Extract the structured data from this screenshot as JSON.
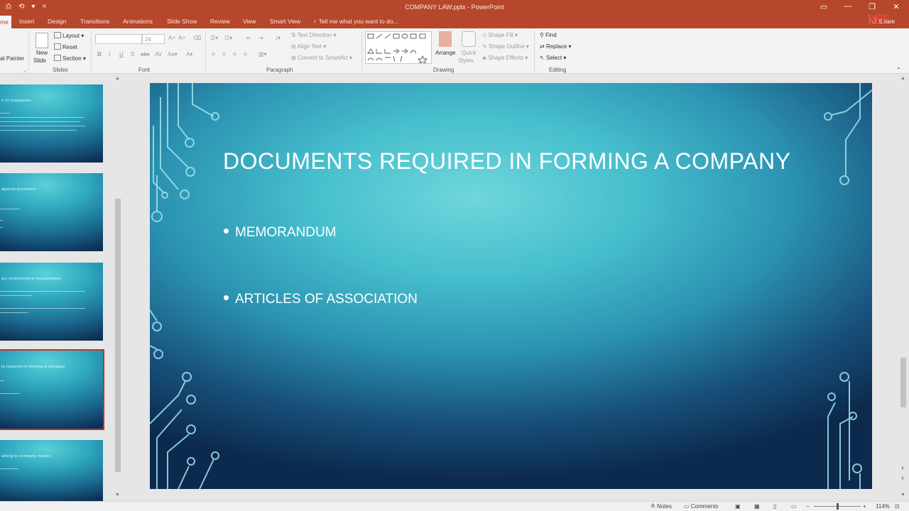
{
  "titlebar": {
    "title": "COMPANY LAW.pptx - PowerPoint",
    "quick_access": [
      "⎙",
      "⟲",
      "▾",
      "="
    ],
    "window_controls": [
      "▭",
      "—",
      "❐",
      "✕"
    ]
  },
  "tabs": [
    "me",
    "Insert",
    "Design",
    "Transitions",
    "Animations",
    "Slide Show",
    "Review",
    "View",
    "Smart View"
  ],
  "tell_me": "Tell me what you want to do...",
  "share": "Share",
  "watermark": "MP",
  "ribbon": {
    "clipboard": {
      "format_painter": "at Painter"
    },
    "slides": {
      "new_slide": "New",
      "new_slide2": "Slide",
      "layout": "Layout",
      "reset": "Reset",
      "section": "Section",
      "label": "Slides"
    },
    "font": {
      "size": "24",
      "label": "Font"
    },
    "paragraph": {
      "text_direction": "Text Direction",
      "align_text": "Align Text",
      "convert_smartart": "Convert to SmartArt",
      "label": "Paragraph"
    },
    "drawing": {
      "arrange": "Arrange",
      "quick_styles": "Quick",
      "quick_styles2": "Styles",
      "shape_fill": "Shape Fill",
      "shape_outline": "Shape Outline",
      "shape_effects": "Shape Effects",
      "label": "Drawing"
    },
    "editing": {
      "find": "Find",
      "replace": "Replace",
      "select": "Select",
      "label": "Editing"
    }
  },
  "thumbnails": [
    {
      "title": "n of companies"
    },
    {
      "title": "against promoters"
    },
    {
      "title": "ary contracts/pre-incorporation"
    },
    {
      "title": "ts required in forming a company"
    },
    {
      "title": "aining to company names"
    }
  ],
  "slide": {
    "title": "DOCUMENTS REQUIRED IN FORMING A COMPANY",
    "bullets": [
      "MEMORANDUM",
      "ARTICLES OF ASSOCIATION"
    ]
  },
  "status": {
    "notes": "Notes",
    "comments": "Comments",
    "zoom": "114%"
  },
  "colors": {
    "accent": "#b7472a",
    "selected_outline": "#c3332a",
    "slide_teal": "#47bfcd",
    "slide_navy": "#0c2a4d"
  }
}
